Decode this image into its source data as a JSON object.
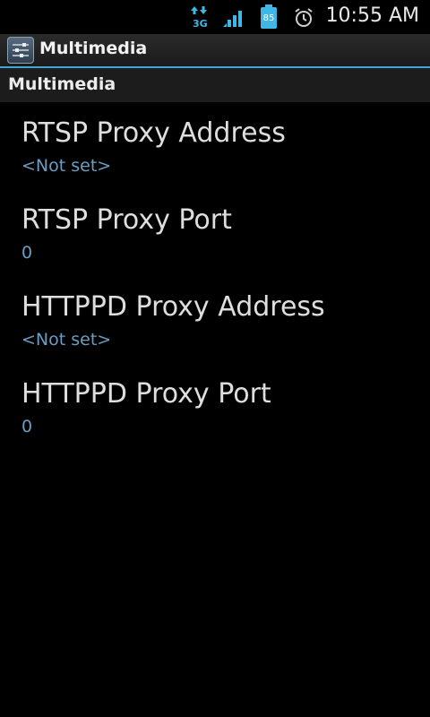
{
  "status_bar": {
    "network_label": "3G",
    "battery_level": "85",
    "time": "10:55 AM",
    "icons": [
      "data-transfer-icon",
      "signal-strength-icon",
      "battery-icon",
      "alarm-clock-icon"
    ]
  },
  "title_bar": {
    "title": "Multimedia",
    "icon": "settings-sliders-icon"
  },
  "category": {
    "title": "Multimedia"
  },
  "preferences": [
    {
      "title": "RTSP Proxy Address",
      "summary": "<Not set>"
    },
    {
      "title": "RTSP Proxy Port",
      "summary": "0"
    },
    {
      "title": "HTTPPD Proxy Address",
      "summary": "<Not set>"
    },
    {
      "title": "HTTPPD Proxy Port",
      "summary": "0"
    }
  ],
  "colors": {
    "accent": "#3fa6d6",
    "summary_text": "#6a9ec3",
    "background": "#000000"
  }
}
